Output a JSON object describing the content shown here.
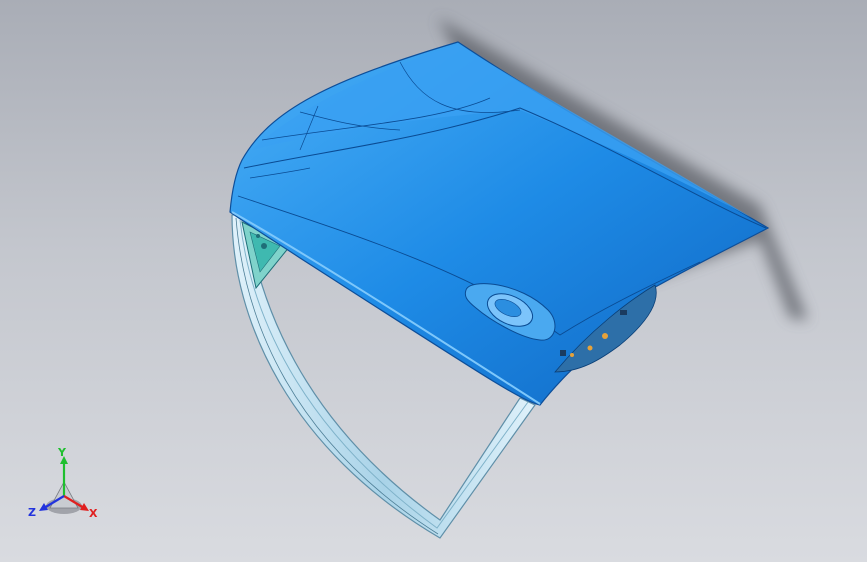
{
  "viewport": {
    "model": "door-assembly",
    "colors": {
      "background_top": "#a9adb6",
      "background_bottom": "#d9dbe0",
      "door_panel": "#1e8be6",
      "door_panel_light": "#4bb0f7",
      "door_panel_dark": "#0d5fb3",
      "window_frame": "#bfe0ef",
      "window_frame_edge": "#5f8fa8",
      "seal_strip": "#e48bd8",
      "inner_bracket": "#3fb9b0"
    }
  },
  "triad": {
    "axes": [
      {
        "label": "Y",
        "color": "#1fbf2f"
      },
      {
        "label": "X",
        "color": "#e02020"
      },
      {
        "label": "Z",
        "color": "#2233dd"
      }
    ]
  }
}
